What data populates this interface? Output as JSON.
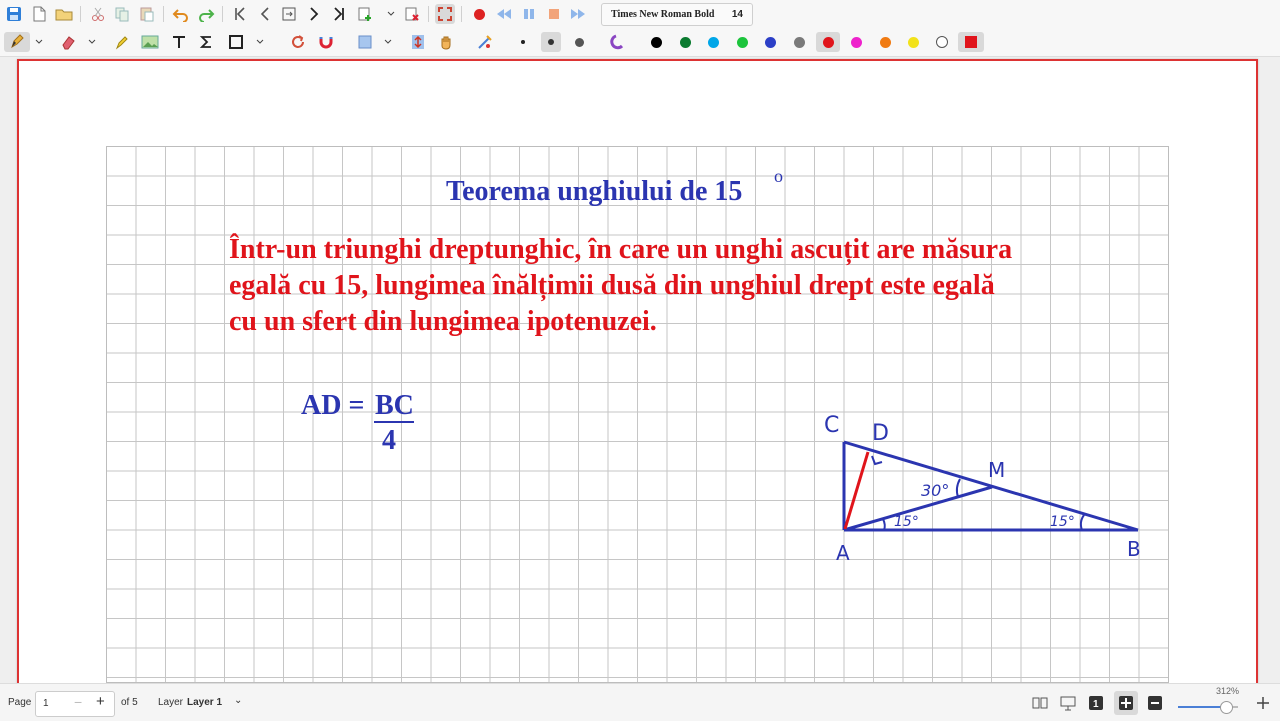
{
  "toolbar": {
    "font_name": "Times New Roman Bold",
    "font_size": "14",
    "palette": [
      "#000000",
      "#0a7a2f",
      "#00a6e8",
      "#1cc43c",
      "#2c3fc7",
      "#7a7a7a",
      "#e0141b",
      "#ee22cc",
      "#f07a12",
      "#f2e21a",
      "#ffffff",
      "#e0141b"
    ],
    "selected_color": "#e0141b"
  },
  "document": {
    "title": "Teorema unghiului de 15",
    "title_degree": "o",
    "theorem_lines": [
      "Într-un triunghi dreptunghic, în care un unghi ascuțit are măsura",
      "egală cu 15, lungimea înălțimii dusă din unghiul drept este egală",
      "cu un sfert din lungimea ipotenuzei."
    ],
    "formula": {
      "lhs": "AD =",
      "numerator": "BC",
      "denominator": "4"
    },
    "diagram": {
      "labels": {
        "C": "C",
        "D": "D",
        "M": "M",
        "A": "A",
        "B": "B"
      },
      "angle_30": "30°",
      "angle_15_a": "15°",
      "angle_15_b": "15°"
    }
  },
  "status": {
    "page_label": "Page",
    "page_value": "1",
    "page_total": "of 5",
    "layer_label": "Layer",
    "layer_value": "Layer 1",
    "zoom": "312%",
    "zoom_fraction": 0.8
  }
}
